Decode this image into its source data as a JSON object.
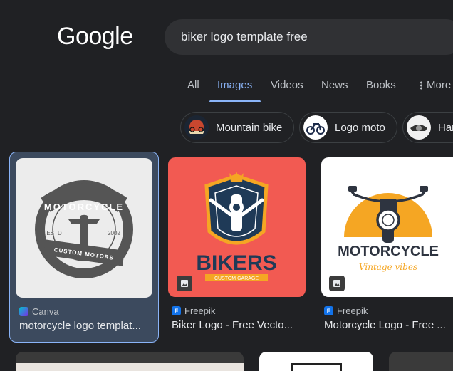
{
  "header": {
    "logo_text": "Google",
    "search_query": "biker logo template free"
  },
  "tabs": [
    {
      "label": "All",
      "active": false
    },
    {
      "label": "Images",
      "active": true
    },
    {
      "label": "Videos",
      "active": false
    },
    {
      "label": "News",
      "active": false
    },
    {
      "label": "Books",
      "active": false
    },
    {
      "label": "More",
      "active": false
    }
  ],
  "chips": [
    {
      "label": "Mountain bike"
    },
    {
      "label": "Logo moto"
    },
    {
      "label": "Harley"
    }
  ],
  "results": [
    {
      "source": "Canva",
      "title": "motorcycle logo templat...",
      "selected": true,
      "image_text": {
        "top": "MOTORCYCLE",
        "left": "ESTD",
        "right": "2002",
        "bottom": "CUSTOM MOTORS"
      }
    },
    {
      "source": "Freepik",
      "title": "Biker Logo - Free Vecto...",
      "selected": false,
      "image_text": {
        "main": "BIKERS",
        "sub": "CUSTOM GARAGE"
      }
    },
    {
      "source": "Freepik",
      "title": "Motorcycle Logo - Free ...",
      "selected": false,
      "image_text": {
        "main": "MOTORCYCLE",
        "sub": "Vintage vibes"
      }
    }
  ],
  "colors": {
    "background": "#202124",
    "accent": "#8ab4f8",
    "selected_card": "#3c4a5e",
    "bikers_bg": "#f25a52",
    "navy": "#1f3a57",
    "orange": "#f5a623"
  }
}
